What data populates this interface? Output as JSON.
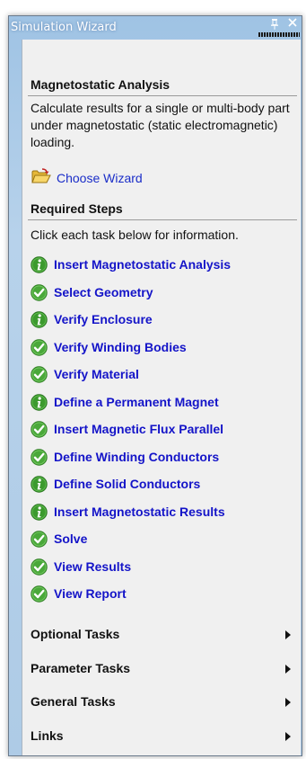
{
  "window": {
    "title": "Simulation Wizard",
    "pin_glyph": "p",
    "close_glyph": "✕"
  },
  "analysis": {
    "heading": "Magnetostatic Analysis",
    "description": "Calculate results for a single or multi-body part under magnetostatic (static electromagnetic) loading.",
    "choose_wizard_label": "Choose Wizard",
    "choose_wizard_icon": "folder-open-icon"
  },
  "required": {
    "heading": "Required Steps",
    "instruction": "Click each task below for information.",
    "steps": [
      {
        "label": "Insert Magnetostatic Analysis",
        "icon": "info-icon"
      },
      {
        "label": "Select Geometry",
        "icon": "check-icon"
      },
      {
        "label": "Verify Enclosure",
        "icon": "info-icon"
      },
      {
        "label": "Verify Winding Bodies",
        "icon": "check-icon"
      },
      {
        "label": "Verify Material",
        "icon": "check-icon"
      },
      {
        "label": "Define a Permanent Magnet",
        "icon": "info-icon"
      },
      {
        "label": "Insert Magnetic Flux Parallel",
        "icon": "check-icon"
      },
      {
        "label": "Define Winding Conductors",
        "icon": "check-icon"
      },
      {
        "label": "Define Solid Conductors",
        "icon": "info-icon"
      },
      {
        "label": "Insert Magnetostatic Results",
        "icon": "info-icon"
      },
      {
        "label": "Solve",
        "icon": "check-icon"
      },
      {
        "label": "View Results",
        "icon": "check-icon"
      },
      {
        "label": "View Report",
        "icon": "check-icon"
      }
    ]
  },
  "more_tasks": [
    {
      "label": "Optional Tasks"
    },
    {
      "label": "Parameter Tasks"
    },
    {
      "label": "General Tasks"
    },
    {
      "label": "Links"
    }
  ],
  "colors": {
    "link_blue": "#1414c8",
    "info_green": "#3c9a2e",
    "check_green": "#4aa83a",
    "panel_bg": "#f0f0f0",
    "title_blue": "#a8c9e8"
  }
}
